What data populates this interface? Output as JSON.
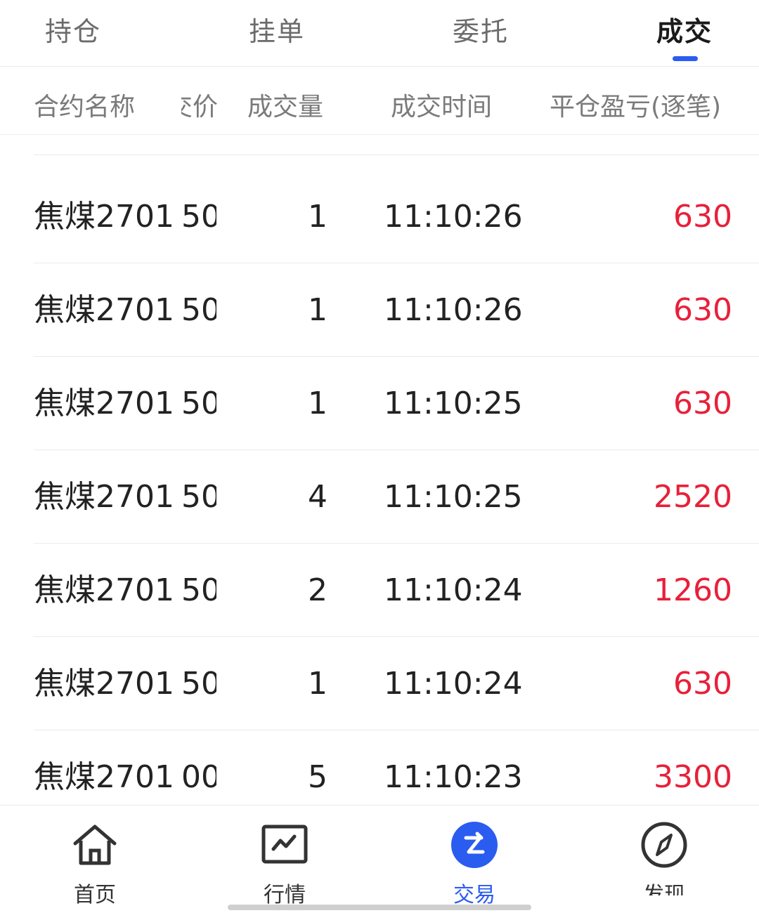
{
  "tabs": [
    {
      "label": "持仓"
    },
    {
      "label": "挂单"
    },
    {
      "label": "委托"
    },
    {
      "label": "成交",
      "active": true
    }
  ],
  "columns": {
    "name": "合约名称",
    "price": "交价",
    "volume": "成交量",
    "time": "成交时间",
    "pnl": "平仓盈亏(逐笔)"
  },
  "rows": [
    {
      "name": "焦煤2701",
      "price": "50",
      "volume": "1",
      "time": "11:10:26",
      "pnl": "630"
    },
    {
      "name": "焦煤2701",
      "price": "50",
      "volume": "1",
      "time": "11:10:26",
      "pnl": "630"
    },
    {
      "name": "焦煤2701",
      "price": "50",
      "volume": "1",
      "time": "11:10:25",
      "pnl": "630"
    },
    {
      "name": "焦煤2701",
      "price": "50",
      "volume": "4",
      "time": "11:10:25",
      "pnl": "2520"
    },
    {
      "name": "焦煤2701",
      "price": "50",
      "volume": "2",
      "time": "11:10:24",
      "pnl": "1260"
    },
    {
      "name": "焦煤2701",
      "price": "50",
      "volume": "1",
      "time": "11:10:24",
      "pnl": "630"
    },
    {
      "name": "焦煤2701",
      "price": "00",
      "volume": "5",
      "time": "11:10:23",
      "pnl": "3300"
    }
  ],
  "bottom_nav": [
    {
      "label": "首页",
      "icon": "home-icon"
    },
    {
      "label": "行情",
      "icon": "chart-icon"
    },
    {
      "label": "交易",
      "icon": "trade-icon",
      "active": true
    },
    {
      "label": "发现",
      "icon": "compass-icon"
    }
  ],
  "colors": {
    "accent": "#2a5cf0",
    "profit": "#e8203a",
    "text": "#222222",
    "muted": "#7a7a7a"
  }
}
